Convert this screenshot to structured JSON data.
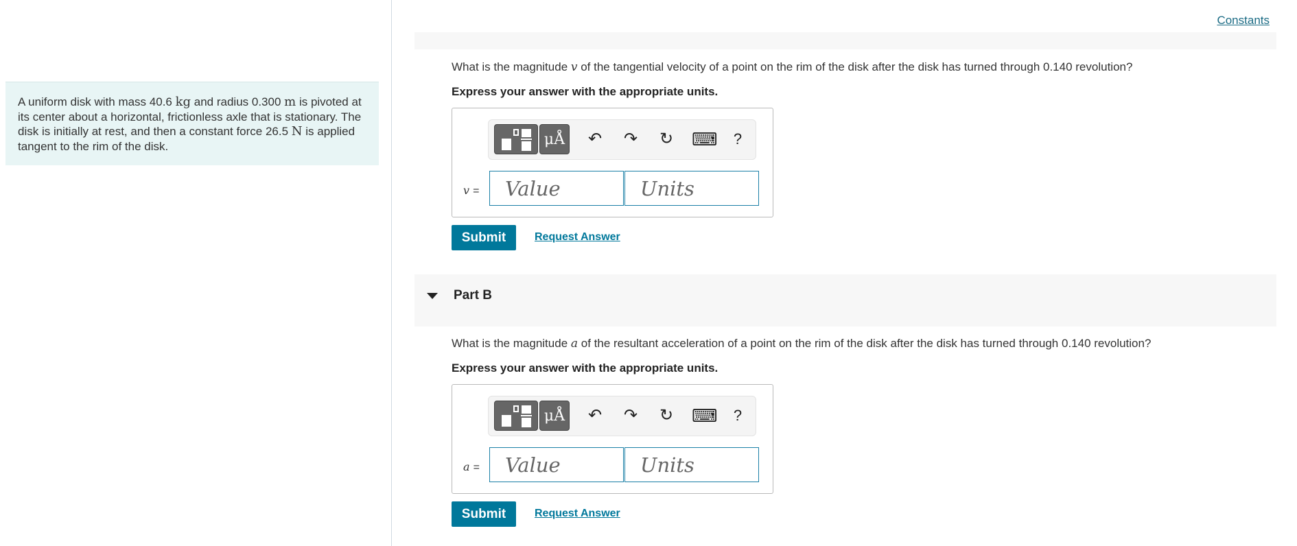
{
  "constants_link": "Constants",
  "problem": {
    "t1": "A uniform disk with mass 40.6 ",
    "u1": "kg",
    "t2": " and radius 0.300 ",
    "u2": "m",
    "t3": " is pivoted at its center about a horizontal, frictionless axle that is stationary. The disk is initially at rest, and then a constant force 26.5 ",
    "u3": "N",
    "t4": " is applied tangent to the rim of the disk."
  },
  "partA": {
    "q_pre": "What is the magnitude ",
    "q_var": "v",
    "q_post": " of the tangential velocity of a point on the rim of the disk after the disk has turned through 0.140 revolution?",
    "instruction": "Express your answer with the appropriate units.",
    "var_label": "v",
    "value_placeholder": "Value",
    "units_placeholder": "Units",
    "submit": "Submit",
    "request": "Request Answer"
  },
  "partB": {
    "title": "Part B",
    "q_pre": "What is the magnitude ",
    "q_var": "a",
    "q_post": " of the resultant acceleration of a point on the rim of the disk after the disk has turned through 0.140 revolution?",
    "instruction": "Express your answer with the appropriate units.",
    "var_label": "a",
    "value_placeholder": "Value",
    "units_placeholder": "Units",
    "submit": "Submit",
    "request": "Request Answer"
  },
  "toolbar": {
    "units_symbol": "μÅ",
    "undo": "↶",
    "redo": "↷",
    "reset": "↻",
    "keyboard": "⌨",
    "help": "?"
  },
  "eq_sign": "="
}
